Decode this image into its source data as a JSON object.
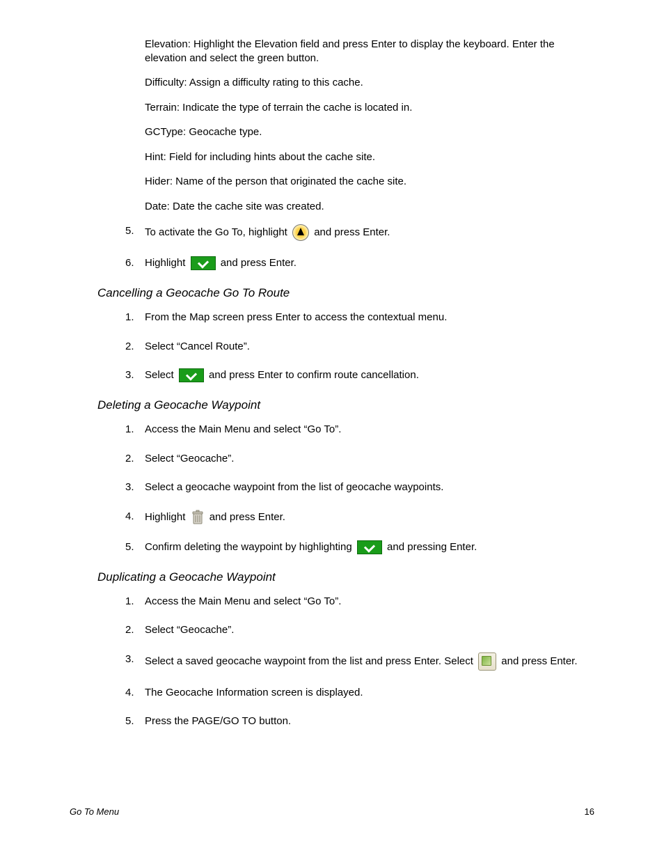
{
  "fields": {
    "elevation": "Elevation: Highlight the Elevation field and press Enter to display the keyboard. Enter the elevation and select the green button.",
    "difficulty": "Difficulty: Assign a difficulty rating to this cache.",
    "terrain": "Terrain: Indicate the type of terrain the cache is located in.",
    "gctype": "GCType: Geocache type.",
    "hint": "Hint: Field for including hints about the cache site.",
    "hider": "Hider: Name of the person that originated the cache site.",
    "date": "Date: Date the cache site was created."
  },
  "continued_steps": {
    "s5_num": "5.",
    "s5_pre": "To activate the Go To, highlight ",
    "s5_post": " and press Enter.",
    "s6_num": "6.",
    "s6_pre": "Highlight ",
    "s6_post": " and press Enter."
  },
  "sections": {
    "cancel": {
      "heading": "Cancelling a Geocache Go To Route",
      "s1_num": "1.",
      "s1": "From the Map screen press Enter to access the contextual menu.",
      "s2_num": "2.",
      "s2": "Select “Cancel Route”.",
      "s3_num": "3.",
      "s3_pre": "Select ",
      "s3_post": " and press Enter to confirm route cancellation."
    },
    "delete": {
      "heading": "Deleting a Geocache Waypoint",
      "s1_num": "1.",
      "s1": "Access the Main Menu and select “Go To”.",
      "s2_num": "2.",
      "s2": "Select “Geocache”.",
      "s3_num": "3.",
      "s3": "Select a geocache waypoint from the list of geocache waypoints.",
      "s4_num": "4.",
      "s4_pre": "Highlight ",
      "s4_post": " and press Enter.",
      "s5_num": "5.",
      "s5_pre": "Confirm deleting the waypoint by highlighting ",
      "s5_post": " and pressing Enter."
    },
    "duplicate": {
      "heading": "Duplicating a Geocache Waypoint",
      "s1_num": "1.",
      "s1": "Access the Main Menu and select “Go To”.",
      "s2_num": "2.",
      "s2": "Select “Geocache”.",
      "s3_num": "3.",
      "s3_pre": "Select a saved geocache waypoint from the list and press Enter. Select ",
      "s3_post": " and press Enter.",
      "s4_num": "4.",
      "s4": "The Geocache Information screen is displayed.",
      "s5_num": "5.",
      "s5": "Press the PAGE/GO TO button."
    }
  },
  "footer": {
    "section": "Go To Menu",
    "page": "16"
  }
}
